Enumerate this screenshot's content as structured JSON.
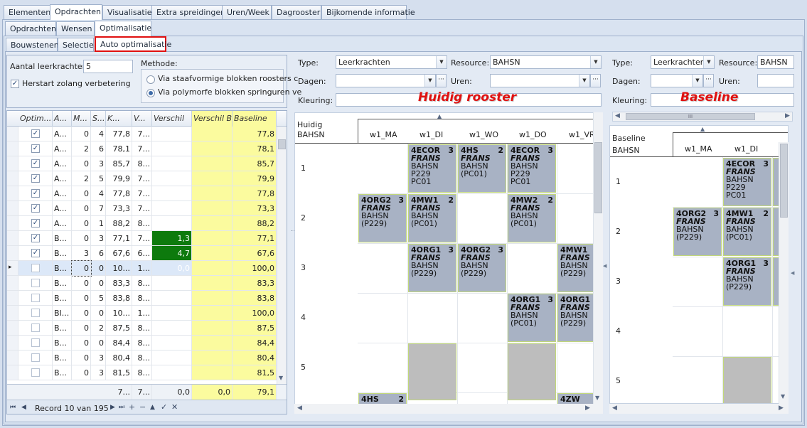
{
  "tabs_main": [
    "Elementen",
    "Opdrachten",
    "Visualisatie",
    "Extra spreidingen",
    "Uren/Week",
    "Dagrooster",
    "Bijkomende informatie"
  ],
  "tabs_sub": [
    "Opdrachten",
    "Wensen",
    "Optimalisatie"
  ],
  "tabs_sub2": [
    "Bouwstenen",
    "Selectie",
    "Auto optimalisatie"
  ],
  "left": {
    "aantal_label": "Aantal leerkrachten:",
    "aantal_value": "5",
    "herstart_label": "Herstart zolang verbetering",
    "methode_label": "Methode:",
    "methode_opt1": "Via staafvormige blokken roosters c",
    "methode_opt2": "Via polymorfe blokken springuren ve"
  },
  "grid": {
    "columns": [
      "Optim...",
      "A...",
      "M...",
      "S...",
      "K...",
      "V...",
      "Verschil",
      "Verschil B",
      "Baseline"
    ],
    "rows": [
      {
        "chk": true,
        "a": "A...",
        "m": "0",
        "s": "4",
        "k": "77,8",
        "v": "7...",
        "vs": "",
        "vb": "",
        "bl": "77,8"
      },
      {
        "chk": true,
        "a": "A...",
        "m": "2",
        "s": "6",
        "k": "78,1",
        "v": "7...",
        "vs": "",
        "vb": "",
        "bl": "78,1"
      },
      {
        "chk": true,
        "a": "A...",
        "m": "0",
        "s": "3",
        "k": "85,7",
        "v": "8...",
        "vs": "",
        "vb": "",
        "bl": "85,7"
      },
      {
        "chk": true,
        "a": "A...",
        "m": "2",
        "s": "5",
        "k": "79,9",
        "v": "7...",
        "vs": "",
        "vb": "",
        "bl": "79,9"
      },
      {
        "chk": true,
        "a": "A...",
        "m": "0",
        "s": "4",
        "k": "77,8",
        "v": "7...",
        "vs": "",
        "vb": "",
        "bl": "77,8"
      },
      {
        "chk": true,
        "a": "A...",
        "m": "0",
        "s": "7",
        "k": "73,3",
        "v": "7...",
        "vs": "",
        "vb": "",
        "bl": "73,3"
      },
      {
        "chk": true,
        "a": "A...",
        "m": "0",
        "s": "1",
        "k": "88,2",
        "v": "8...",
        "vs": "",
        "vb": "",
        "bl": "88,2"
      },
      {
        "chk": true,
        "a": "B...",
        "m": "0",
        "s": "3",
        "k": "77,1",
        "v": "7...",
        "vs": "1,3",
        "vb": "",
        "bl": "77,1"
      },
      {
        "chk": true,
        "a": "B...",
        "m": "3",
        "s": "6",
        "k": "67,6",
        "v": "6...",
        "vs": "4,7",
        "vb": "",
        "bl": "67,6"
      },
      {
        "chk": false,
        "a": "B...",
        "m": "0",
        "s": "0",
        "k": "10...",
        "v": "1...",
        "vs": "0,0",
        "vb": "",
        "bl": "100,0"
      },
      {
        "chk": false,
        "a": "B...",
        "m": "0",
        "s": "0",
        "k": "83,3",
        "v": "8...",
        "vs": "",
        "vb": "",
        "bl": "83,3"
      },
      {
        "chk": false,
        "a": "B...",
        "m": "0",
        "s": "5",
        "k": "83,8",
        "v": "8...",
        "vs": "",
        "vb": "",
        "bl": "83,8"
      },
      {
        "chk": false,
        "a": "BI...",
        "m": "0",
        "s": "0",
        "k": "10...",
        "v": "1...",
        "vs": "",
        "vb": "",
        "bl": "100,0"
      },
      {
        "chk": false,
        "a": "B...",
        "m": "0",
        "s": "2",
        "k": "87,5",
        "v": "8...",
        "vs": "",
        "vb": "",
        "bl": "87,5"
      },
      {
        "chk": false,
        "a": "B...",
        "m": "0",
        "s": "0",
        "k": "84,4",
        "v": "8...",
        "vs": "",
        "vb": "",
        "bl": "84,4"
      },
      {
        "chk": false,
        "a": "B...",
        "m": "0",
        "s": "3",
        "k": "80,4",
        "v": "8...",
        "vs": "",
        "vb": "",
        "bl": "80,4"
      },
      {
        "chk": false,
        "a": "B...",
        "m": "0",
        "s": "3",
        "k": "81,5",
        "v": "8...",
        "vs": "",
        "vb": "",
        "bl": "81,5"
      }
    ],
    "footer": {
      "k": "7...",
      "v": "7...",
      "vs": "0,0",
      "vb": "0,0",
      "bl": "79,1"
    },
    "nav_record": "Record 10 van 195"
  },
  "mid": {
    "type_label": "Type:",
    "type_value": "Leerkrachten",
    "resource_label": "Resource:",
    "resource_value": "BAHSN",
    "dagen_label": "Dagen:",
    "uren_label": "Uren:",
    "kleuring_label": "Kleuring:",
    "title": "Huidig rooster",
    "corner1": "Huidig",
    "corner2": "BAHSN",
    "days": [
      "w1_MA",
      "w1_DI",
      "w1_WO",
      "w1_DO",
      "w1_VR"
    ],
    "hours": [
      "1",
      "2",
      "3",
      "4",
      "5"
    ]
  },
  "right": {
    "type_label": "Type:",
    "type_value": "Leerkrachten",
    "resource_label": "Resource:",
    "resource_value": "BAHSN",
    "dagen_label": "Dagen:",
    "uren_label": "Uren:",
    "kleuring_label": "Kleuring:",
    "title": "Baseline",
    "corner1": "Baseline",
    "corner2": "BAHSN",
    "days": [
      "w1_MA",
      "w1_DI"
    ],
    "hours": [
      "1",
      "2",
      "3",
      "4",
      "5"
    ],
    "scroll_grip": "III"
  },
  "cards_mid": [
    {
      "code": "4ECOR",
      "n": "3",
      "t": "FRANS",
      "r": "BAHSN",
      "l1": "P229",
      "l2": "PC01"
    },
    {
      "code": "4HS",
      "n": "2",
      "t": "FRANS",
      "r": "BAHSN",
      "l1": "(PC01)",
      "l2": ""
    },
    {
      "code": "4ECOR",
      "n": "3",
      "t": "FRANS",
      "r": "BAHSN",
      "l1": "P229",
      "l2": "PC01"
    },
    {
      "code": "4ORG2",
      "n": "3",
      "t": "FRANS",
      "r": "BAHSN",
      "l1": "(P229)",
      "l2": ""
    },
    {
      "code": "4MW1",
      "n": "2",
      "t": "FRANS",
      "r": "BAHSN",
      "l1": "(PC01)",
      "l2": ""
    },
    {
      "code": "4MW2",
      "n": "2",
      "t": "FRANS",
      "r": "BAHSN",
      "l1": "(PC01)",
      "l2": ""
    },
    {
      "code": "4ORG1",
      "n": "3",
      "t": "FRANS",
      "r": "BAHSN",
      "l1": "(P229)",
      "l2": ""
    },
    {
      "code": "4ORG2",
      "n": "3",
      "t": "FRANS",
      "r": "BAHSN",
      "l1": "(P229)",
      "l2": ""
    },
    {
      "code": "4MW1",
      "n": "",
      "t": "FRANS",
      "r": "BAHSN",
      "l1": "(P229)",
      "l2": ""
    },
    {
      "code": "4ORG1",
      "n": "3",
      "t": "FRANS",
      "r": "BAHSN",
      "l1": "(PC01)",
      "l2": ""
    },
    {
      "code": "4ORG1",
      "n": "",
      "t": "FRANS",
      "r": "BAHSN",
      "l1": "(P229)",
      "l2": ""
    },
    {
      "code": "4HS",
      "n": "2",
      "t": "",
      "r": "",
      "l1": "",
      "l2": ""
    },
    {
      "code": "4ZW",
      "n": "",
      "t": "",
      "r": "",
      "l1": "",
      "l2": ""
    }
  ],
  "cards_right": [
    {
      "code": "4ECOR",
      "n": "3",
      "t": "FRANS",
      "r": "BAHSN",
      "l1": "P229",
      "l2": "PC01"
    },
    {
      "code": "4ORG2",
      "n": "3",
      "t": "FRANS",
      "r": "BAHSN",
      "l1": "(P229)",
      "l2": ""
    },
    {
      "code": "4MW1",
      "n": "2",
      "t": "FRANS",
      "r": "BAHSN",
      "l1": "(PC01)",
      "l2": ""
    },
    {
      "code": "4ORG1",
      "n": "3",
      "t": "FRANS",
      "r": "BAHSN",
      "l1": "(P229)",
      "l2": ""
    }
  ],
  "colors": {
    "accent_red": "#e01010",
    "verschil_green": "#0d7a0d",
    "highlight_yellow": "#fbfb9e"
  }
}
